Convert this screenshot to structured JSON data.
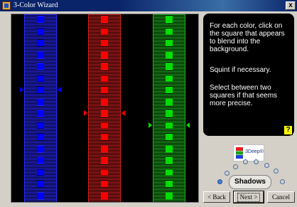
{
  "window": {
    "title": "3-Color Wizard",
    "close_label": "x"
  },
  "strips": [
    {
      "name": "blue",
      "color": "#0000ff",
      "line_color": "#2a2aff",
      "square_color": "#0000ff",
      "highlight_row": 6
    },
    {
      "name": "red",
      "color": "#cc0000",
      "line_color": "#d02020",
      "square_color": "#ff0000",
      "highlight_row": 8
    },
    {
      "name": "green",
      "color": "#00aa00",
      "line_color": "#20b020",
      "square_color": "#00dd00",
      "highlight_row": 9
    }
  ],
  "info": {
    "line1": "For each color, click on the square that appears to blend into the background.",
    "line2": "Squint if necessary.",
    "line3": "Select between two squares if that seems more precise.",
    "help_label": "?"
  },
  "logo": {
    "text": "3Deep®"
  },
  "mode": {
    "label": "Shadows"
  },
  "nav": {
    "back_label": "< Back",
    "next_label": "Next >",
    "cancel_label": "Cancel"
  }
}
